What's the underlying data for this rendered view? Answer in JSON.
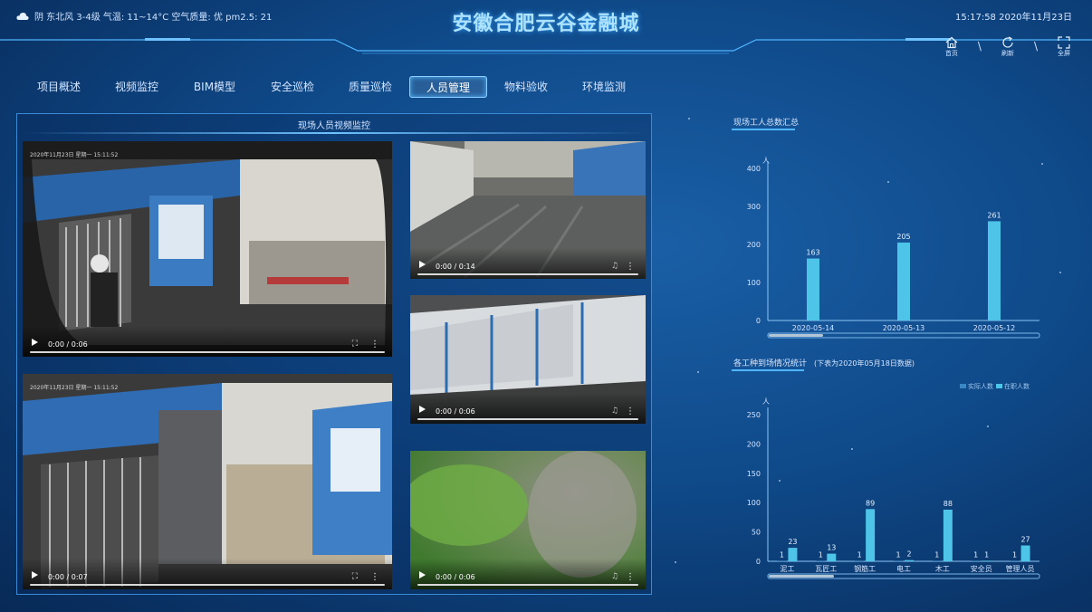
{
  "header": {
    "weather": "阴 东北风 3-4级 气温: 11~14°C 空气质量: 优 pm2.5: 21",
    "title": "安徽合肥云谷金融城",
    "clock": "15:17:58 2020年11月23日",
    "icons": [
      {
        "name": "home-icon",
        "label": "首页"
      },
      {
        "name": "refresh-icon",
        "label": "刷新"
      },
      {
        "name": "fullscreen-icon",
        "label": "全屏"
      }
    ]
  },
  "nav": {
    "items": [
      "项目概述",
      "视频监控",
      "BIM模型",
      "安全巡检",
      "质量巡检",
      "人员管理",
      "物料验收",
      "环境监测"
    ],
    "active": "人员管理"
  },
  "video_panel": {
    "title": "现场人员视频监控",
    "videos": [
      {
        "stamp": "2020年11月23日 星期一 15:11:52",
        "time": "0:00 / 0:06"
      },
      {
        "stamp": "",
        "time": "0:00 / 0:14"
      },
      {
        "stamp": "",
        "time": "0:00 / 0:06"
      },
      {
        "stamp": "2020年11月23日 星期一 15:11:52",
        "time": "0:00 / 0:07"
      },
      {
        "stamp": "",
        "time": "0:00 / 0:06"
      }
    ]
  },
  "chart_data": [
    {
      "type": "bar",
      "title": "现场工人总数汇总",
      "ylabel": "人",
      "ylim": [
        0,
        400
      ],
      "yticks": [
        0,
        100,
        200,
        300,
        400
      ],
      "categories": [
        "2020-05-14",
        "2020-05-13",
        "2020-05-12"
      ],
      "values": [
        163,
        205,
        261
      ],
      "colors": {
        "bar": "#4dc4e8"
      }
    },
    {
      "type": "bar",
      "title": "各工种到场情况统计",
      "note": "(下表为2020年05月18日数据)",
      "ylabel": "人",
      "ylim": [
        0,
        250
      ],
      "yticks": [
        0,
        50,
        100,
        150,
        200,
        250
      ],
      "categories": [
        "泥工",
        "瓦匠工",
        "钢筋工",
        "电工",
        "木工",
        "安全员",
        "管理人员"
      ],
      "series": [
        {
          "name": "实际人数",
          "values": [
            1,
            1,
            1,
            1,
            1,
            1,
            1
          ],
          "color": "#3a87c4"
        },
        {
          "name": "在职人数",
          "values": [
            23,
            13,
            89,
            2,
            88,
            1,
            27
          ],
          "color": "#4dc4e8"
        }
      ],
      "legend": "top-right"
    }
  ]
}
